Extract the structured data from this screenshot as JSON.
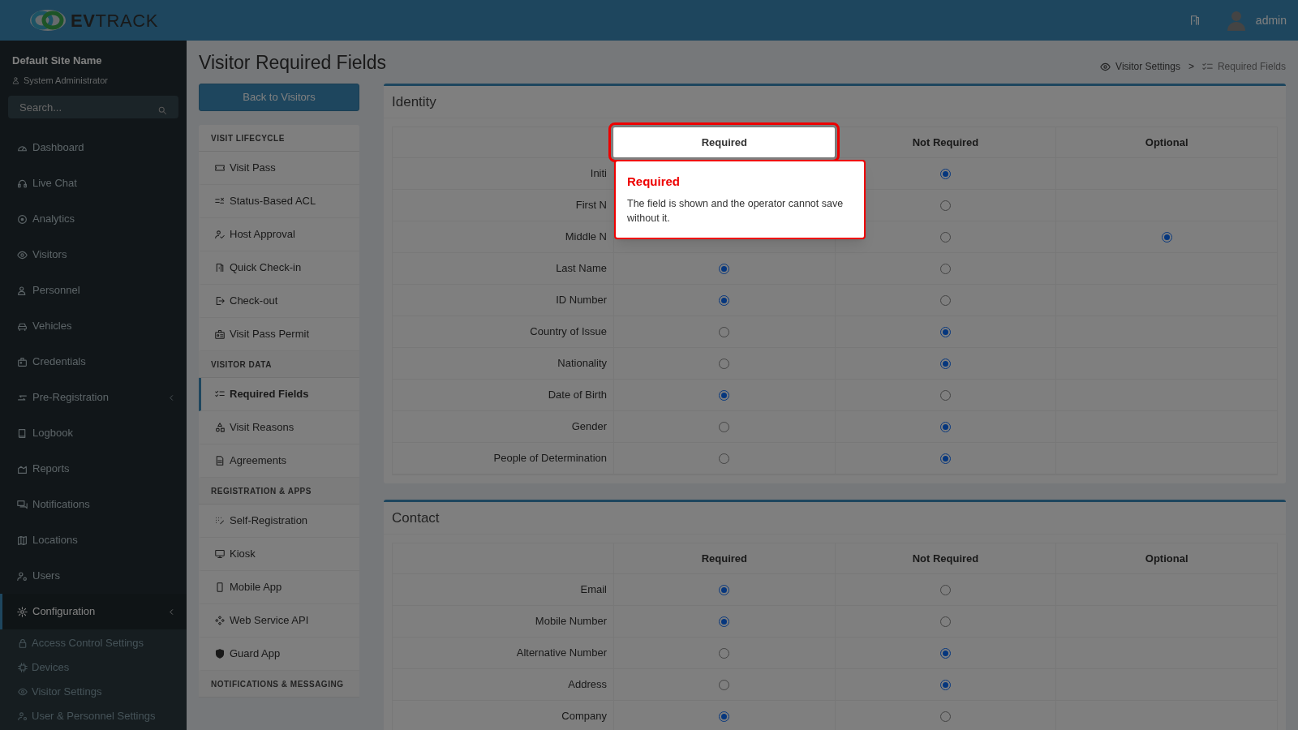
{
  "logo": {
    "bold": "EV",
    "light": "TRACK"
  },
  "header": {
    "user": "admin"
  },
  "sidebar": {
    "site_name": "Default Site Name",
    "role": "System Administrator",
    "search": {
      "placeholder": "Search..."
    },
    "items": [
      {
        "label": "Dashboard",
        "selected": false,
        "has_submenu": false
      },
      {
        "label": "Live Chat",
        "selected": false,
        "has_submenu": false
      },
      {
        "label": "Analytics",
        "selected": false,
        "has_submenu": false
      },
      {
        "label": "Visitors",
        "selected": false,
        "has_submenu": false
      },
      {
        "label": "Personnel",
        "selected": false,
        "has_submenu": false
      },
      {
        "label": "Vehicles",
        "selected": false,
        "has_submenu": false
      },
      {
        "label": "Credentials",
        "selected": false,
        "has_submenu": false
      },
      {
        "label": "Pre-Registration",
        "selected": false,
        "has_submenu": true
      },
      {
        "label": "Logbook",
        "selected": false,
        "has_submenu": false
      },
      {
        "label": "Reports",
        "selected": false,
        "has_submenu": false
      },
      {
        "label": "Notifications",
        "selected": false,
        "has_submenu": false
      },
      {
        "label": "Locations",
        "selected": false,
        "has_submenu": false
      },
      {
        "label": "Users",
        "selected": false,
        "has_submenu": false
      },
      {
        "label": "Configuration",
        "selected": true,
        "has_submenu": true,
        "children": [
          {
            "label": "Access Control Settings"
          },
          {
            "label": "Devices"
          },
          {
            "label": "Visitor Settings"
          },
          {
            "label": "User & Personnel Settings"
          }
        ]
      }
    ]
  },
  "page": {
    "title": "Visitor Required Fields",
    "back_button": "Back to Visitors",
    "breadcrumb": {
      "parent": "Visitor Settings",
      "separator": ">",
      "current": "Required Fields"
    }
  },
  "subnav": [
    {
      "heading": "VISIT LIFECYCLE",
      "items": [
        {
          "label": "Visit Pass",
          "selected": false
        },
        {
          "label": "Status-Based ACL",
          "selected": false
        },
        {
          "label": "Host Approval",
          "selected": false
        },
        {
          "label": "Quick Check-in",
          "selected": false
        },
        {
          "label": "Check-out",
          "selected": false
        },
        {
          "label": "Visit Pass Permit",
          "selected": false
        }
      ]
    },
    {
      "heading": "VISITOR DATA",
      "items": [
        {
          "label": "Required Fields",
          "selected": true
        },
        {
          "label": "Visit Reasons",
          "selected": false
        },
        {
          "label": "Agreements",
          "selected": false
        }
      ]
    },
    {
      "heading": "REGISTRATION & APPS",
      "items": [
        {
          "label": "Self-Registration",
          "selected": false
        },
        {
          "label": "Kiosk",
          "selected": false
        },
        {
          "label": "Mobile App",
          "selected": false
        },
        {
          "label": "Web Service API",
          "selected": false
        },
        {
          "label": "Guard App",
          "selected": false
        }
      ]
    },
    {
      "heading": "NOTIFICATIONS & MESSAGING"
    }
  ],
  "sections": [
    {
      "title": "Identity",
      "columns": [
        {
          "label": "Required",
          "highlighted": true
        },
        {
          "label": "Not Required",
          "highlighted": false
        },
        {
          "label": "Optional",
          "highlighted": false
        }
      ],
      "tooltip": {
        "title": "Required",
        "text": "The field is shown and the operator cannot save without it."
      },
      "rows": [
        {
          "label": "Initi",
          "not_required": {
            "selected": true
          }
        },
        {
          "label": "First N",
          "not_required": {
            "selected": false
          }
        },
        {
          "label": "Middle N",
          "not_required": {
            "selected": false
          },
          "optional": {
            "selected": true
          }
        },
        {
          "label": "Last Name",
          "required": {
            "selected": true
          },
          "not_required": {
            "selected": false
          }
        },
        {
          "label": "ID Number",
          "required": {
            "selected": true
          },
          "not_required": {
            "selected": false
          }
        },
        {
          "label": "Country of Issue",
          "required": {
            "selected": false
          },
          "not_required": {
            "selected": true
          }
        },
        {
          "label": "Nationality",
          "required": {
            "selected": false
          },
          "not_required": {
            "selected": true
          }
        },
        {
          "label": "Date of Birth",
          "required": {
            "selected": true
          },
          "not_required": {
            "selected": false
          }
        },
        {
          "label": "Gender",
          "required": {
            "selected": false
          },
          "not_required": {
            "selected": true
          }
        },
        {
          "label": "People of Determination",
          "required": {
            "selected": false
          },
          "not_required": {
            "selected": true
          }
        }
      ]
    },
    {
      "title": "Contact",
      "columns": [
        {
          "label": "Required",
          "highlighted": false
        },
        {
          "label": "Not Required",
          "highlighted": false
        },
        {
          "label": "Optional",
          "highlighted": false
        }
      ],
      "rows": [
        {
          "label": "Email",
          "required": {
            "selected": true
          },
          "not_required": {
            "selected": false
          }
        },
        {
          "label": "Mobile Number",
          "required": {
            "selected": true
          },
          "not_required": {
            "selected": false
          }
        },
        {
          "label": "Alternative Number",
          "required": {
            "selected": false
          },
          "not_required": {
            "selected": true
          }
        },
        {
          "label": "Address",
          "required": {
            "selected": false
          },
          "not_required": {
            "selected": true
          }
        },
        {
          "label": "Company",
          "required": {
            "selected": true
          },
          "not_required": {
            "selected": false
          }
        }
      ]
    }
  ]
}
